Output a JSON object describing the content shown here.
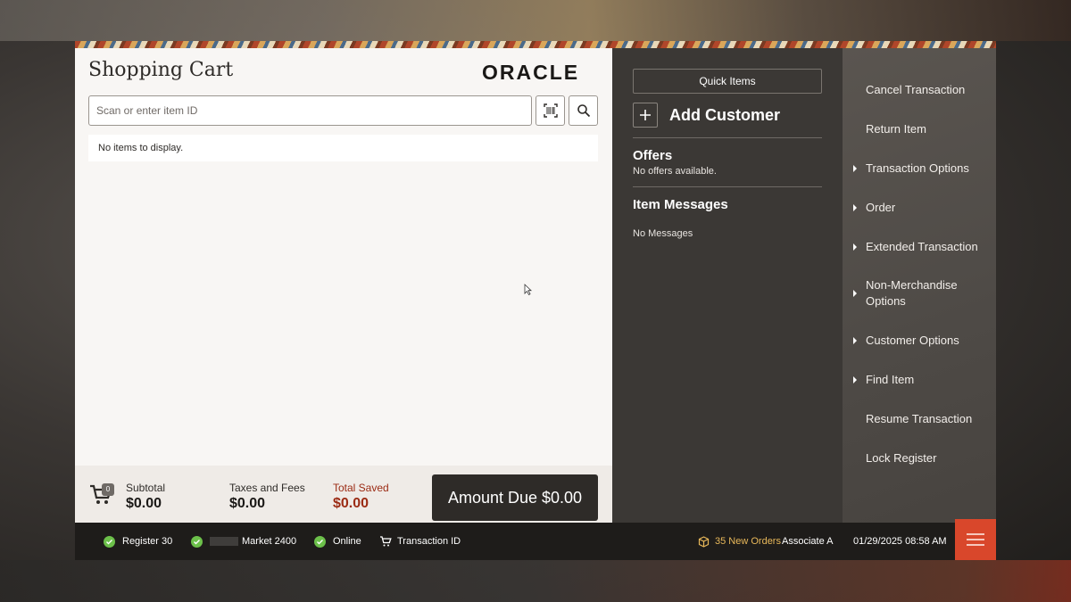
{
  "header": {
    "title": "Shopping Cart",
    "logo_text": "ORACLE"
  },
  "search": {
    "placeholder": "Scan or enter item ID",
    "value": "",
    "scan_icon": "barcode-scan-icon",
    "search_icon": "magnifier-icon"
  },
  "cart": {
    "empty_message": "No items to display.",
    "item_count": "0"
  },
  "totals": {
    "subtotal_label": "Subtotal",
    "subtotal_value": "$0.00",
    "taxes_label": "Taxes and Fees",
    "taxes_value": "$0.00",
    "saved_label": "Total Saved",
    "saved_value": "$0.00",
    "amount_due": "Amount Due $0.00"
  },
  "middle": {
    "quick_items": "Quick Items",
    "add_customer": "Add Customer",
    "offers_title": "Offers",
    "offers_text": "No offers available.",
    "messages_title": "Item Messages",
    "messages_text": "No Messages"
  },
  "menu": {
    "items": [
      {
        "label": "Cancel Transaction",
        "submenu": false
      },
      {
        "label": "Return Item",
        "submenu": false
      },
      {
        "label": "Transaction Options",
        "submenu": true
      },
      {
        "label": "Order",
        "submenu": true
      },
      {
        "label": "Extended Transaction",
        "submenu": true
      },
      {
        "label": "Non-Merchandise Options",
        "submenu": true
      },
      {
        "label": "Customer Options",
        "submenu": true
      },
      {
        "label": "Find Item",
        "submenu": true
      },
      {
        "label": "Resume Transaction",
        "submenu": false
      },
      {
        "label": "Lock Register",
        "submenu": false
      }
    ]
  },
  "status": {
    "register": "Register 30",
    "store": "Market 2400",
    "connection": "Online",
    "transaction": "Transaction ID",
    "orders": "35 New Orders",
    "associate": "Associate A",
    "datetime": "01/29/2025 08:58 AM"
  },
  "colors": {
    "accent": "#d9472b",
    "ok": "#6cc04a",
    "saved": "#9b2b14",
    "orders": "#e8b85a"
  }
}
